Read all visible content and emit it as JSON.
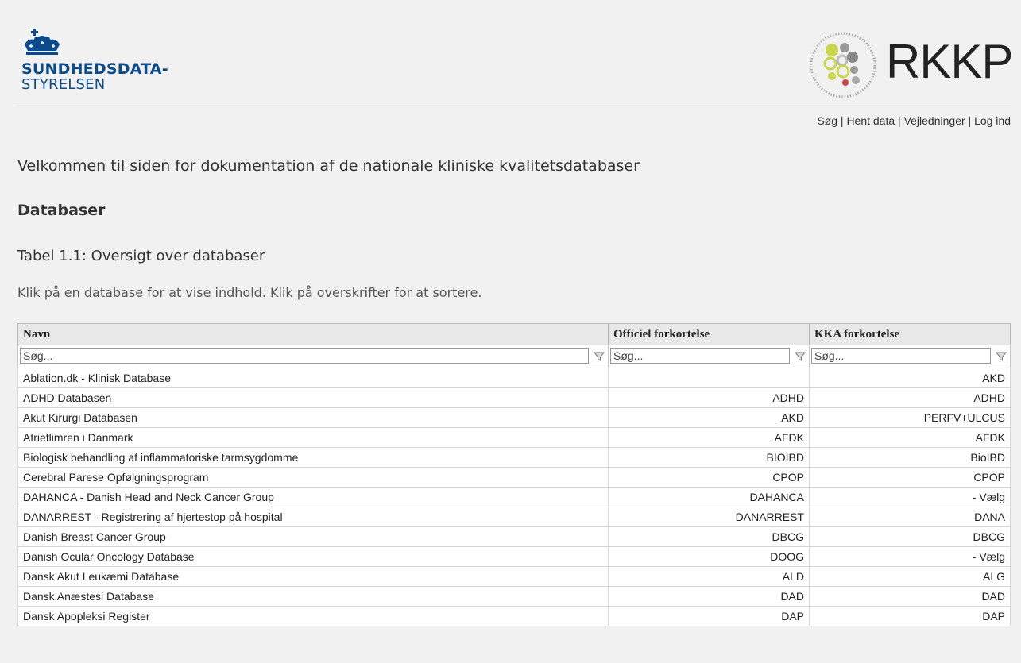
{
  "header": {
    "sds_logo_line1": "SUNDHEDSDATA-",
    "sds_logo_line2": "STYRELSEN",
    "rkkp_logo_text": "RKKP"
  },
  "nav": {
    "items": [
      "Søg",
      "Hent data",
      "Vejledninger",
      "Log ind"
    ],
    "separator": "|"
  },
  "intro_text": "Velkommen til siden for dokumentation af de nationale kliniske kvalitetsdatabaser",
  "section_title": "Databaser",
  "table_caption": "Tabel 1.1: Oversigt over databaser",
  "hint_text": "Klik på en database for at vise indhold. Klik på overskrifter for at sortere.",
  "table": {
    "columns": [
      "Navn",
      "Officiel forkortelse",
      "KKA forkortelse"
    ],
    "filter_placeholder": "Søg...",
    "rows": [
      [
        "Ablation.dk - Klinisk Database",
        "",
        "AKD"
      ],
      [
        "ADHD Databasen",
        "ADHD",
        "ADHD"
      ],
      [
        "Akut Kirurgi Databasen",
        "AKD",
        "PERFV+ULCUS"
      ],
      [
        "Atrieflimren i Danmark",
        "AFDK",
        "AFDK"
      ],
      [
        "Biologisk behandling af inflammatoriske tarmsygdomme",
        "BIOIBD",
        "BioIBD"
      ],
      [
        "Cerebral Parese Opfølgningsprogram",
        "CPOP",
        "CPOP"
      ],
      [
        "DAHANCA - Danish Head and Neck Cancer Group",
        "DAHANCA",
        "- Vælg"
      ],
      [
        "DANARREST - Registrering af hjertestop på hospital",
        "DANARREST",
        "DANA"
      ],
      [
        "Danish Breast Cancer Group",
        "DBCG",
        "DBCG"
      ],
      [
        "Danish Ocular Oncology Database",
        "DOOG",
        "- Vælg"
      ],
      [
        "Dansk Akut Leukæmi Database",
        "ALD",
        "ALG"
      ],
      [
        "Dansk Anæstesi Database",
        "DAD",
        "DAD"
      ],
      [
        "Dansk Apopleksi Register",
        "DAP",
        "DAP"
      ]
    ]
  },
  "colors": {
    "sds_blue": "#0b4b8c",
    "background": "#f1f1f1",
    "header_row": "#e8e8e8"
  }
}
